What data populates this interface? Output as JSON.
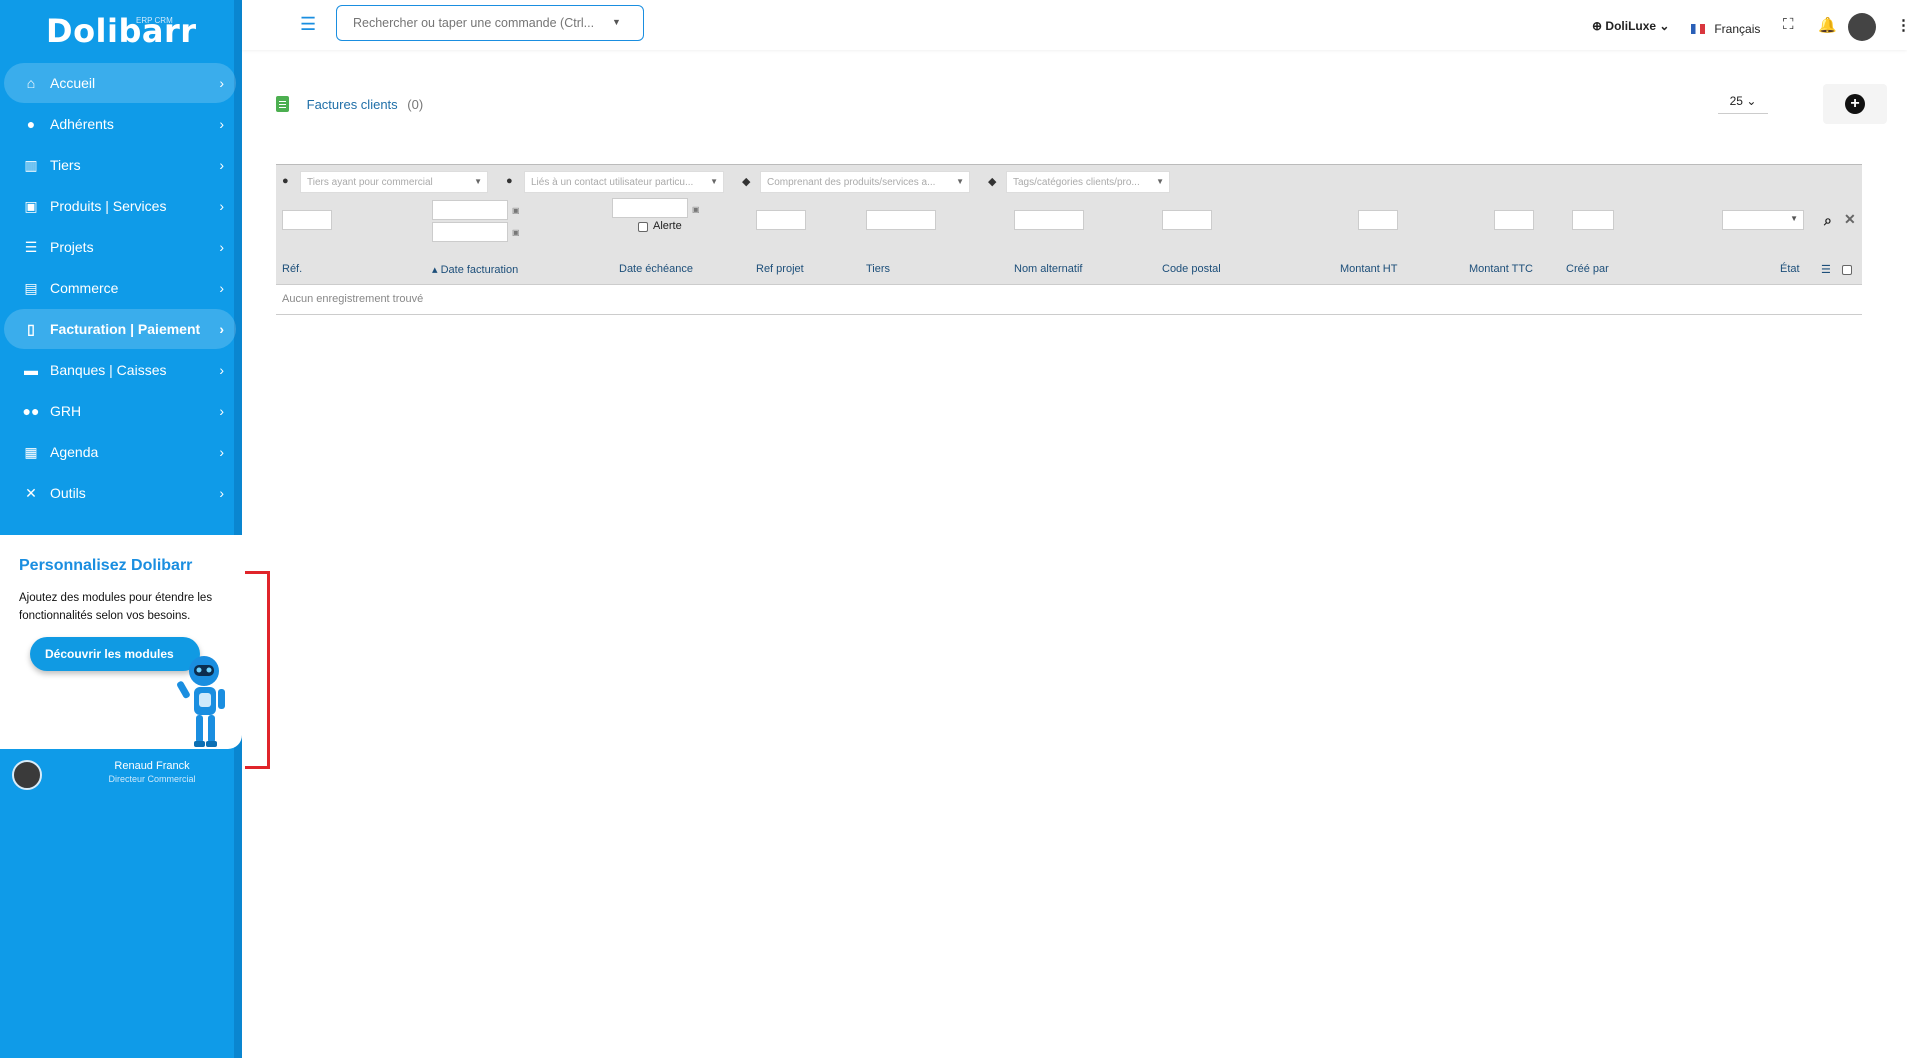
{
  "app": {
    "logo": "Dolibarr",
    "logo_sub": "ERP CRM"
  },
  "sidebar": {
    "items": [
      {
        "label": "Accueil",
        "icon": "home-icon"
      },
      {
        "label": "Adhérents",
        "icon": "user-icon"
      },
      {
        "label": "Tiers",
        "icon": "bank-icon"
      },
      {
        "label": "Produits | Services",
        "icon": "cubes-icon"
      },
      {
        "label": "Projets",
        "icon": "list-icon"
      },
      {
        "label": "Commerce",
        "icon": "briefcase-icon"
      },
      {
        "label": "Facturation | Paiement",
        "icon": "file-icon"
      },
      {
        "label": "Banques | Caisses",
        "icon": "bank-card-icon"
      },
      {
        "label": "GRH",
        "icon": "users-icon"
      },
      {
        "label": "Agenda",
        "icon": "calendar-icon"
      },
      {
        "label": "Outils",
        "icon": "tools-icon"
      }
    ],
    "promo": {
      "title": "Personnalisez Dolibarr",
      "text": "Ajoutez des modules pour étendre les fonctionnalités selon vos besoins.",
      "button": "Découvrir les modules"
    },
    "user": {
      "name": "Renaud Franck",
      "role": "Directeur Commercial"
    }
  },
  "topbar": {
    "search_placeholder": "Rechercher ou taper une commande (Ctrl...",
    "entity": "DoliLuxe",
    "language": "Français"
  },
  "page": {
    "title": "Factures clients",
    "count": "(0)",
    "per_page": "25"
  },
  "filters": {
    "sales_rep": "Tiers ayant pour commercial",
    "contact": "Liés à un contact utilisateur particu...",
    "products": "Comprenant des produits/services a...",
    "tags": "Tags/catégories clients/pro...",
    "alert_label": "Alerte"
  },
  "table": {
    "columns": [
      "Réf.",
      "Date facturation",
      "Date échéance",
      "Ref projet",
      "Tiers",
      "Nom alternatif",
      "Code postal",
      "Montant HT",
      "Montant TTC",
      "Créé par",
      "État"
    ],
    "empty": "Aucun enregistrement trouvé"
  },
  "colors": {
    "sidebar": "#0f9be8",
    "accent": "#1a8ee0",
    "highlight": "#e0242a"
  }
}
